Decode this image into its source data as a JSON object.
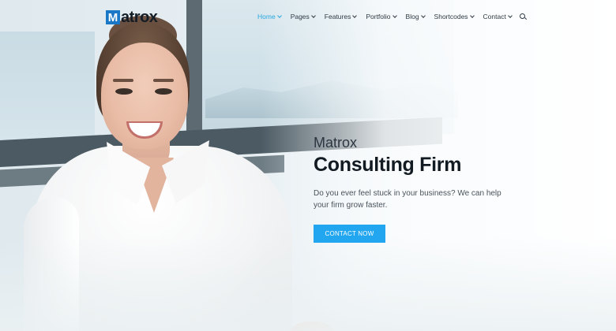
{
  "brand": {
    "logo_mark": "M",
    "logo_text": "atrox",
    "accent_color": "#29a8e0",
    "logo_color": "#1b78c7"
  },
  "nav": {
    "items": [
      {
        "label": "Home",
        "active": true
      },
      {
        "label": "Pages",
        "active": false
      },
      {
        "label": "Features",
        "active": false
      },
      {
        "label": "Portfolio",
        "active": false
      },
      {
        "label": "Blog",
        "active": false
      },
      {
        "label": "Shortcodes",
        "active": false
      },
      {
        "label": "Contact",
        "active": false
      }
    ],
    "search_icon": "search-icon"
  },
  "hero": {
    "kicker": "Matrox",
    "title": "Consulting Firm",
    "description": "Do you ever feel stuck in your business? We can help your firm grow faster.",
    "cta_label": "CONTACT NOW",
    "cta_color": "#22a6f0"
  }
}
